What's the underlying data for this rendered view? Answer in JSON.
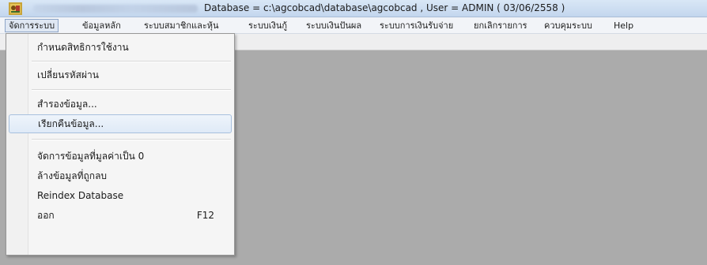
{
  "titlebar": {
    "title": "Database = c:\\agcobcad\\database\\agcobcad , User = ADMIN ( 03/06/2558 )"
  },
  "menubar": {
    "items": [
      {
        "label": "จัดการระบบ"
      },
      {
        "label": "ข้อมูลหลัก"
      },
      {
        "label": "ระบบสมาชิกและหุ้น"
      },
      {
        "label": "ระบบเงินกู้"
      },
      {
        "label": "ระบบเงินปันผล"
      },
      {
        "label": "ระบบการเงินรับจ่าย"
      },
      {
        "label": "ยกเลิกรายการ"
      },
      {
        "label": "ควบคุมระบบ"
      },
      {
        "label": "Help"
      }
    ]
  },
  "dropdown": {
    "items": [
      {
        "label": "กำหนดสิทธิการใช้งาน",
        "shortcut": ""
      },
      {
        "label": "เปลี่ยนรหัสผ่าน",
        "shortcut": ""
      },
      {
        "label": "สำรองข้อมูล...",
        "shortcut": ""
      },
      {
        "label": "เรียกคืนข้อมูล...",
        "shortcut": ""
      },
      {
        "label": "จัดการข้อมูลที่มูลค่าเป็น 0",
        "shortcut": ""
      },
      {
        "label": "ล้างข้อมูลที่ถูกลบ",
        "shortcut": ""
      },
      {
        "label": "Reindex Database",
        "shortcut": ""
      },
      {
        "label": "ออก",
        "shortcut": "F12"
      }
    ]
  },
  "icons": {
    "app": "app-icon"
  },
  "colors": {
    "client_background": "#ababab",
    "highlight_border": "#a7c0de",
    "titlebar": "#c3d6ee"
  }
}
